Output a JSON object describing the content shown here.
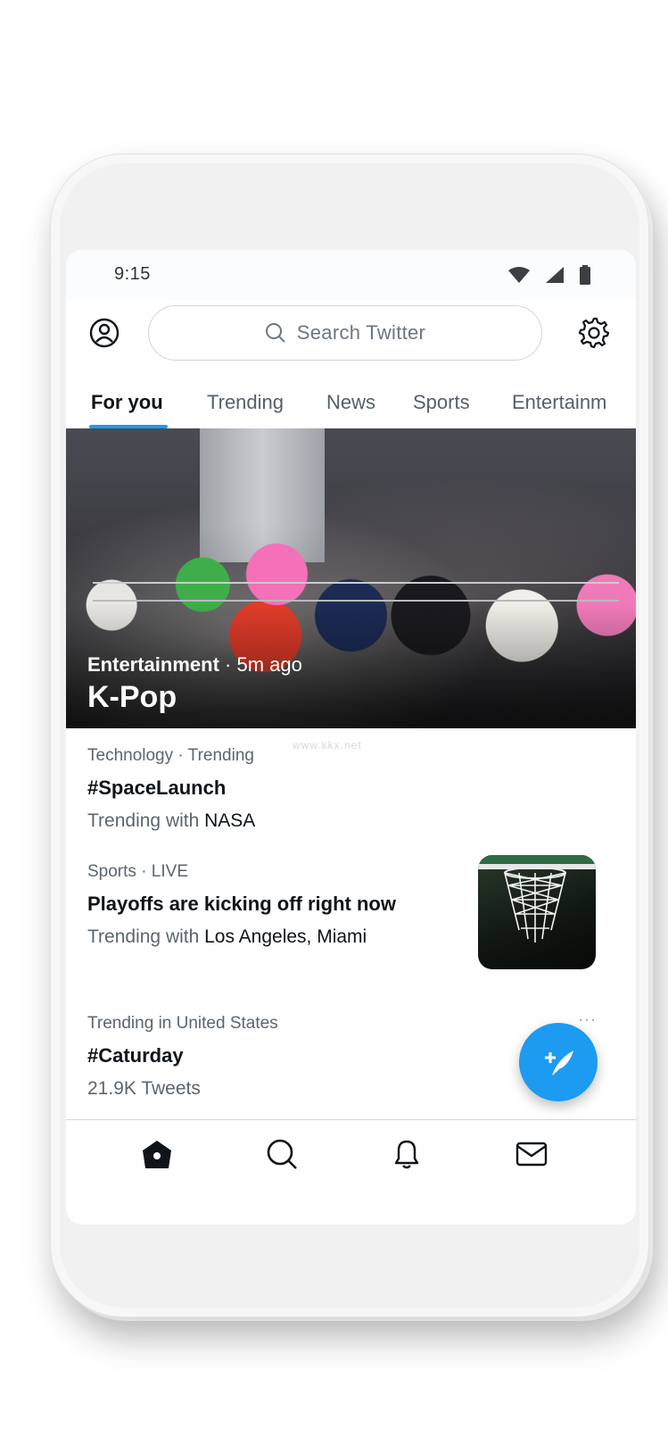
{
  "status_bar": {
    "time": "9:15"
  },
  "header": {
    "search_placeholder": "Search Twitter"
  },
  "tabs": [
    {
      "label": "For you",
      "active": true
    },
    {
      "label": "Trending",
      "active": false
    },
    {
      "label": "News",
      "active": false
    },
    {
      "label": "Sports",
      "active": false
    },
    {
      "label": "Entertainm",
      "active": false
    }
  ],
  "hero": {
    "category": "Entertainment",
    "time": " · 5m ago",
    "title": "K-Pop"
  },
  "trends": [
    {
      "meta": "Technology · Trending",
      "title": "#SpaceLaunch",
      "sub_prefix": "Trending with ",
      "sub_value": "NASA"
    },
    {
      "meta": "Sports · LIVE",
      "title": "Playoffs are kicking off right now",
      "sub_prefix": "Trending with ",
      "sub_value": "Los Angeles, Miami"
    },
    {
      "meta": "Trending in United States",
      "title": "#Caturday",
      "sub_prefix": "21.9K Tweets",
      "sub_value": ""
    }
  ],
  "more_label": "···",
  "watermark": "www.kkx.net",
  "colors": {
    "accent": "#1d9bf0",
    "text": "#0f1419",
    "secondary": "#5b6570"
  },
  "icons": [
    "wifi-icon",
    "signal-icon",
    "battery-icon",
    "profile-icon",
    "search-icon",
    "settings-icon",
    "compose-icon",
    "home-icon",
    "explore-icon",
    "notifications-icon",
    "messages-icon"
  ]
}
